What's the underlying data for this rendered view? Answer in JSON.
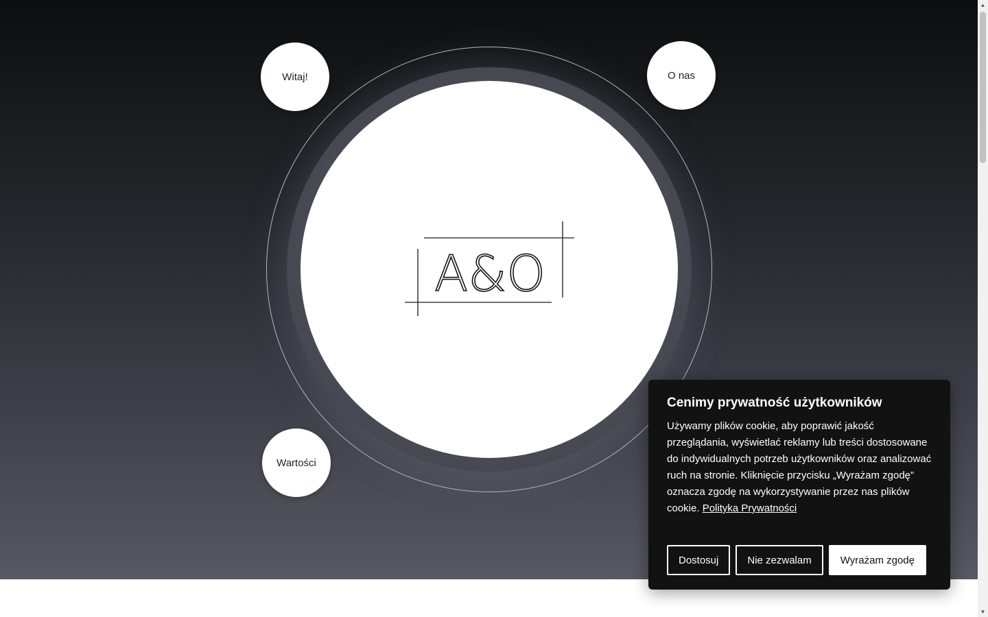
{
  "logo": {
    "text": "A&O"
  },
  "nav": {
    "welcome": "Witaj!",
    "about": "O nas",
    "values": "Wartości"
  },
  "cookie": {
    "title": "Cenimy prywatność użytkowników",
    "body": "Używamy plików cookie, aby poprawić jakość przeglądania, wyświetlać reklamy lub treści dostosowane do indywidualnych potrzeb użytkowników oraz analizować ruch na stronie. Kliknięcie przycisku „Wyrażam zgodę” oznacza zgodę na wykorzystywanie przez nas plików cookie.",
    "policy_link": "Polityka Prywatności",
    "customize_label": "Dostosuj",
    "reject_label": "Nie zezwalam",
    "accept_label": "Wyrażam zgodę"
  },
  "colors": {
    "hero_top": "#0d0e10",
    "hero_bottom": "#565961",
    "panel_bg": "#121212",
    "accent": "#ffffff"
  }
}
